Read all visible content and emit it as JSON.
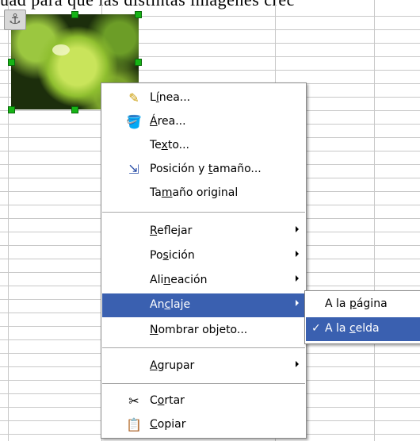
{
  "document": {
    "top_text": "uad para que las distintas imágenes crec"
  },
  "image": {
    "anchor_icon": "⚓"
  },
  "context_menu": {
    "items": [
      {
        "pre": "L",
        "u": "í",
        "post": "nea...",
        "icon": "✎"
      },
      {
        "pre": "",
        "u": "Á",
        "post": "rea...",
        "icon": "🪣"
      },
      {
        "pre": "Te",
        "u": "x",
        "post": "to...",
        "icon": ""
      },
      {
        "pre": "Posición y ",
        "u": "t",
        "post": "amaño...",
        "icon": "⇲"
      },
      {
        "pre": "Ta",
        "u": "m",
        "post": "año original",
        "icon": ""
      },
      {
        "pre": "",
        "u": "R",
        "post": "eflejar",
        "icon": ""
      },
      {
        "pre": "Po",
        "u": "s",
        "post": "ición",
        "icon": ""
      },
      {
        "pre": "Ali",
        "u": "n",
        "post": "eación",
        "icon": ""
      },
      {
        "pre": "An",
        "u": "c",
        "post": "laje",
        "icon": ""
      },
      {
        "pre": "",
        "u": "N",
        "post": "ombrar objeto...",
        "icon": ""
      },
      {
        "pre": "",
        "u": "A",
        "post": "grupar",
        "icon": ""
      },
      {
        "pre": "C",
        "u": "o",
        "post": "rtar",
        "icon": "✂"
      },
      {
        "pre": "",
        "u": "C",
        "post": "opiar",
        "icon": "📋"
      }
    ]
  },
  "anchor_submenu": {
    "items": [
      {
        "pre": "A la ",
        "u": "p",
        "post": "ágina",
        "checked": false
      },
      {
        "pre": "A la ",
        "u": "c",
        "post": "elda",
        "checked": true,
        "check_glyph": "✓"
      }
    ]
  }
}
